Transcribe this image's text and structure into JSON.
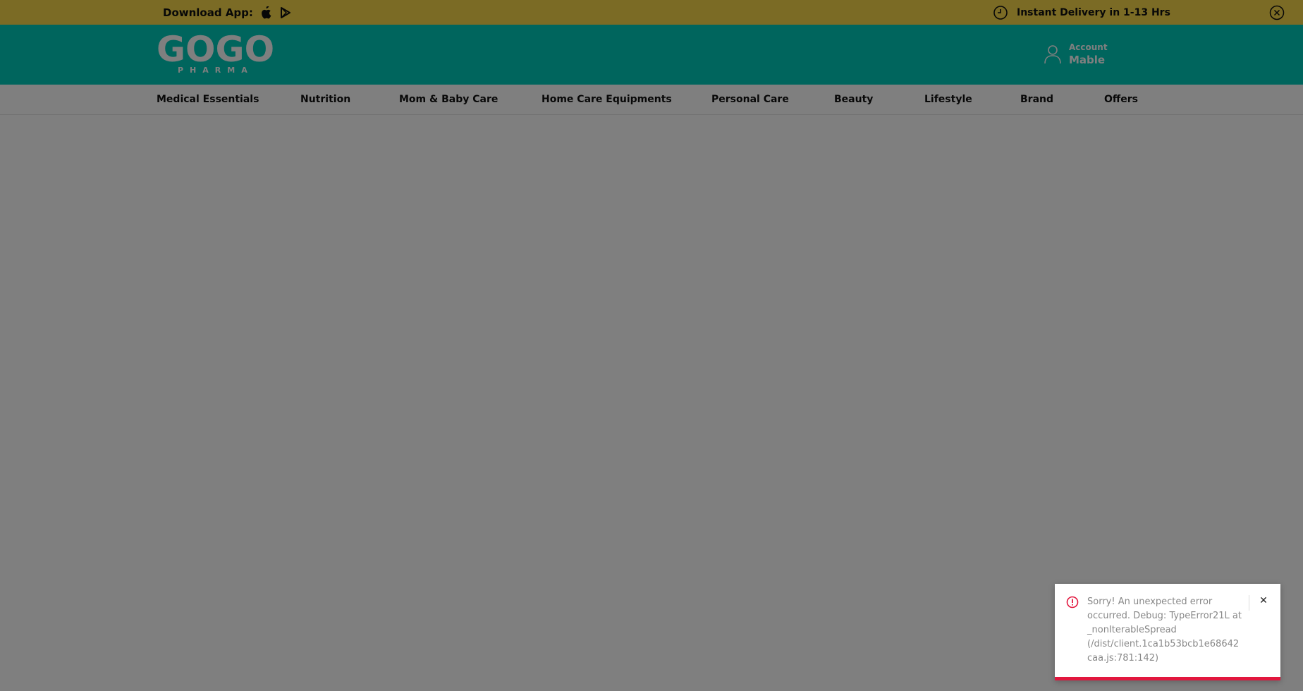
{
  "topbar": {
    "download_label": "Download App:",
    "app_icons": [
      "apple-icon",
      "google-play-icon"
    ],
    "delivery_text": "Instant Delivery in 1-13 Hrs",
    "delivery_icon": "clock-icon",
    "close_icon": "close-circle-icon"
  },
  "header": {
    "logo_text": "GOGO",
    "logo_subtext": "PHARMA",
    "account_label": "Account",
    "account_name": "Mable",
    "account_icon": "user-icon"
  },
  "nav": {
    "items": [
      {
        "label": "Medical Essentials"
      },
      {
        "label": "Nutrition"
      },
      {
        "label": "Mom & Baby Care"
      },
      {
        "label": "Home Care Equipments"
      },
      {
        "label": "Personal Care"
      },
      {
        "label": "Beauty"
      },
      {
        "label": "Lifestyle"
      },
      {
        "label": "Brand"
      },
      {
        "label": "Offers"
      }
    ]
  },
  "toast": {
    "message": "Sorry! An unexpected error occurred. Debug: TypeError21L at _nonIterableSpread (/dist/client.1ca1b53bcb1e68642caa.js:781:142)",
    "close_label": "✕",
    "icon": "error-circle-icon"
  },
  "colors": {
    "topbar_bg": "#F7D74A",
    "header_bg": "#00CBBB",
    "overlay": "rgba(0,0,0,0.5)",
    "error_accent": "#E2173E"
  }
}
